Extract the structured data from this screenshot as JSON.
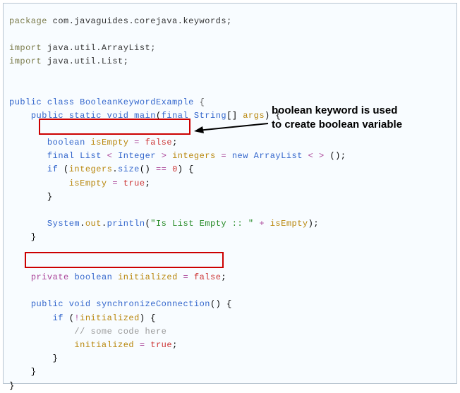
{
  "code": {
    "l1_package": "package",
    "l1_pkg_name": " com.javaguides.corejava.keywords;",
    "l3_import": "import",
    "l3_text": " java.util.ArrayList;",
    "l4_import": "import",
    "l4_text": " java.util.List;",
    "l6_public": "public",
    "l6_class": "class",
    "l6_name": "BooleanKeywordExample",
    "l7_public": "public",
    "l7_static": "static",
    "l7_void": "void",
    "l7_main": "main",
    "l7_final": "final",
    "l7_string": "String",
    "l7_args": "args",
    "l9_boolean": "boolean",
    "l9_var": "isEmpty",
    "l9_eq": "=",
    "l9_false": "false",
    "l10_final": "final",
    "l10_list": "List",
    "l10_lt": "<",
    "l10_integer": "Integer",
    "l10_gt": ">",
    "l10_var": "integers",
    "l10_eq": "=",
    "l10_new": "new",
    "l10_arraylist": "ArrayList",
    "l10_diamond": "< >",
    "l11_if": "if",
    "l11_var": "integers",
    "l11_size": "size",
    "l11_eqeq": "==",
    "l11_zero": "0",
    "l12_var": "isEmpty",
    "l12_eq": "=",
    "l12_true": "true",
    "l15_sys": "System",
    "l15_out": "out",
    "l15_println": "println",
    "l15_str": "\"Is List Empty :: \"",
    "l15_plus": "+",
    "l15_var": "isEmpty",
    "l18_private": "private",
    "l18_boolean": "boolean",
    "l18_var": "initialized",
    "l18_eq": "=",
    "l18_false": "false",
    "l20_public": "public",
    "l20_void": "void",
    "l20_name": "synchronizeConnection",
    "l21_if": "if",
    "l21_not": "!",
    "l21_var": "initialized",
    "l22_comment": "// some code here",
    "l23_var": "initialized",
    "l23_eq": "=",
    "l23_true": "true"
  },
  "annotation": {
    "line1": "boolean keyword is used",
    "line2": "to create boolean variable"
  }
}
